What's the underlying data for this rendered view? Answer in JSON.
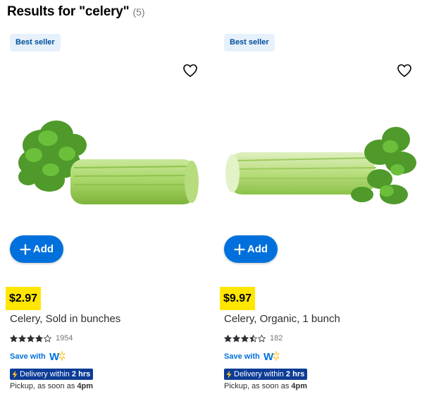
{
  "results": {
    "title": "Results for \"celery\"",
    "count": "(5)"
  },
  "colors": {
    "accent": "#0071dc",
    "price_highlight": "#ffe600",
    "badge_bg": "#e6f1fc",
    "badge_text": "#004f9a",
    "delivery_bg": "#0d3c96",
    "star": "#2e2f32"
  },
  "products": [
    {
      "badge": "Best seller",
      "favorite_icon": "heart-outline-icon",
      "add_label": "Add",
      "price": "$2.97",
      "name": "Celery, Sold in bunches",
      "rating": 4,
      "rating_count": "1954",
      "save_label": "Save with",
      "delivery_prefix": "Delivery within",
      "delivery_time": "2 hrs",
      "pickup_prefix": "Pickup, as soon as",
      "pickup_time": "4pm"
    },
    {
      "badge": "Best seller",
      "favorite_icon": "heart-outline-icon",
      "add_label": "Add",
      "price": "$9.97",
      "name": "Celery, Organic, 1 bunch",
      "rating": 3.5,
      "rating_count": "182",
      "save_label": "Save with",
      "delivery_prefix": "Delivery within",
      "delivery_time": "2 hrs",
      "pickup_prefix": "Pickup, as soon as",
      "pickup_time": "4pm"
    }
  ]
}
